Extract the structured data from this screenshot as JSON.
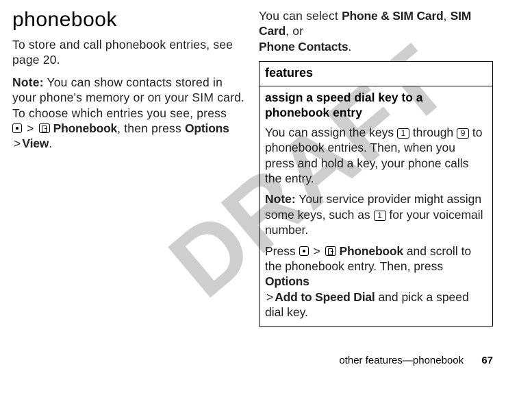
{
  "watermark": "DRAFT",
  "left": {
    "heading": "phonebook",
    "intro": "To store and call phonebook entries, see page 20.",
    "note_label": "Note:",
    "note_body_1": " You can show contacts stored in your phone's memory or on your SIM card. To choose which entries you see, press",
    "nav_gt1": ">",
    "nav_phonebook": "Phonebook",
    "nav_then": ", then press ",
    "nav_options": "Options",
    "nav_gt2": ">",
    "nav_view": "View",
    "nav_period": "."
  },
  "right": {
    "intro_1": "You can select ",
    "opt1": "Phone & SIM Card",
    "sep1": ", ",
    "opt2": "SIM Card",
    "sep2": ", or ",
    "opt3": "Phone Contacts",
    "intro_end": ".",
    "table_header": "features",
    "cell": {
      "title": "assign a speed dial key to a phonebook entry",
      "p1_a": "You can assign the keys ",
      "key1": "1",
      "p1_b": " through ",
      "key9": "9",
      "p1_c": " to phonebook entries. Then, when you press and hold a key, your phone calls the entry.",
      "note_label": "Note:",
      "note_body": " Your service provider might assign some keys, such as ",
      "note_key": "1",
      "note_tail": " for your voicemail number.",
      "p3_a": "Press ",
      "p3_gt1": ">",
      "p3_phonebook": "Phonebook",
      "p3_b": " and scroll to the phonebook entry. Then, press ",
      "p3_options": "Options",
      "p3_gt2": ">",
      "p3_add": "Add to Speed Dial",
      "p3_c": " and pick a speed dial key."
    }
  },
  "footer": {
    "section": "other features—phonebook",
    "page": "67"
  }
}
